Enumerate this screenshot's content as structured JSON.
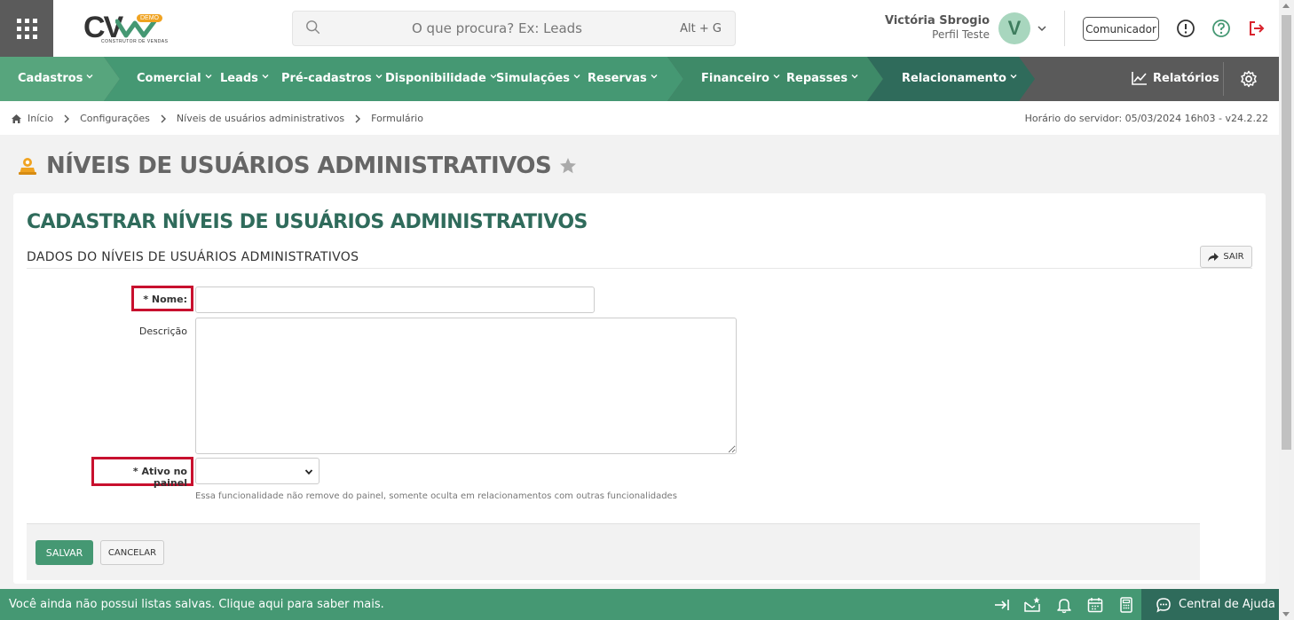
{
  "header": {
    "logo_text": "CV",
    "logo_badge": "DEMO",
    "logo_subtitle": "CONSTRUTOR DE VENDAS",
    "search_placeholder": "O que procura? Ex: Leads",
    "search_shortcut": "Alt + G",
    "user_name": "Victória Sbrogio",
    "user_role": "Perfil Teste",
    "avatar_initial": "V",
    "communicator_label": "Comunicador"
  },
  "nav": {
    "items": [
      {
        "label": "Cadastros"
      },
      {
        "label": "Comercial"
      },
      {
        "label": "Leads"
      },
      {
        "label": "Pré-cadastros"
      },
      {
        "label": "Disponibilidade"
      },
      {
        "label": "Simulações"
      },
      {
        "label": "Reservas"
      },
      {
        "label": "Financeiro"
      },
      {
        "label": "Repasses"
      },
      {
        "label": "Relacionamento"
      }
    ],
    "reports_label": "Relatórios",
    "colors": {
      "seg1": "#57a57d",
      "seg2": "#459873",
      "seg3": "#3e8a68",
      "seg4": "#2f6b5b",
      "rest": "#5a5a5a"
    }
  },
  "breadcrumb": {
    "items": [
      "Início",
      "Configurações",
      "Níveis de usuários administrativos",
      "Formulário"
    ],
    "server_time": "Horário do servidor: 05/03/2024 16h03 - v24.2.22"
  },
  "page": {
    "title": "NÍVEIS DE USUÁRIOS ADMINISTRATIVOS"
  },
  "form": {
    "card_title": "CADASTRAR NÍVEIS DE USUÁRIOS ADMINISTRATIVOS",
    "section_title": "DADOS DO NÍVEIS DE USUÁRIOS ADMINISTRATIVOS",
    "exit_label": "SAIR",
    "name_label": "* Nome:",
    "name_value": "",
    "description_label": "Descrição",
    "description_value": "",
    "active_label": "* Ativo no painel",
    "active_value": "",
    "active_help": "Essa funcionalidade não remove do painel, somente oculta em relacionamentos com outras funcionalidades",
    "save_label": "SALVAR",
    "cancel_label": "CANCELAR"
  },
  "footer": {
    "message": "Você ainda não possui listas salvas. Clique aqui para saber mais.",
    "help_center_label": "Central de Ajuda"
  },
  "colors": {
    "brand_green": "#459873",
    "dark_green": "#2f6b5b",
    "highlight_red": "#c8102e",
    "logout_red": "#d9232d"
  }
}
